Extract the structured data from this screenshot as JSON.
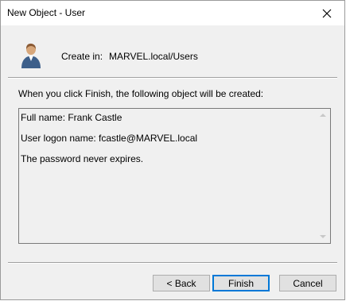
{
  "window": {
    "title": "New Object - User"
  },
  "header": {
    "create_in_label": "Create in:",
    "create_in_value": "MARVEL.local/Users"
  },
  "summary": {
    "description": "When you click Finish, the following object will be created:",
    "lines": [
      "Full name: Frank Castle",
      "User logon name: fcastle@MARVEL.local",
      "The password never expires."
    ]
  },
  "buttons": {
    "back": "< Back",
    "finish": "Finish",
    "cancel": "Cancel"
  },
  "icons": {
    "close": "close-icon",
    "user": "user-icon"
  },
  "colors": {
    "accent": "#0078d7",
    "dialog_bg": "#f0f0f0"
  }
}
